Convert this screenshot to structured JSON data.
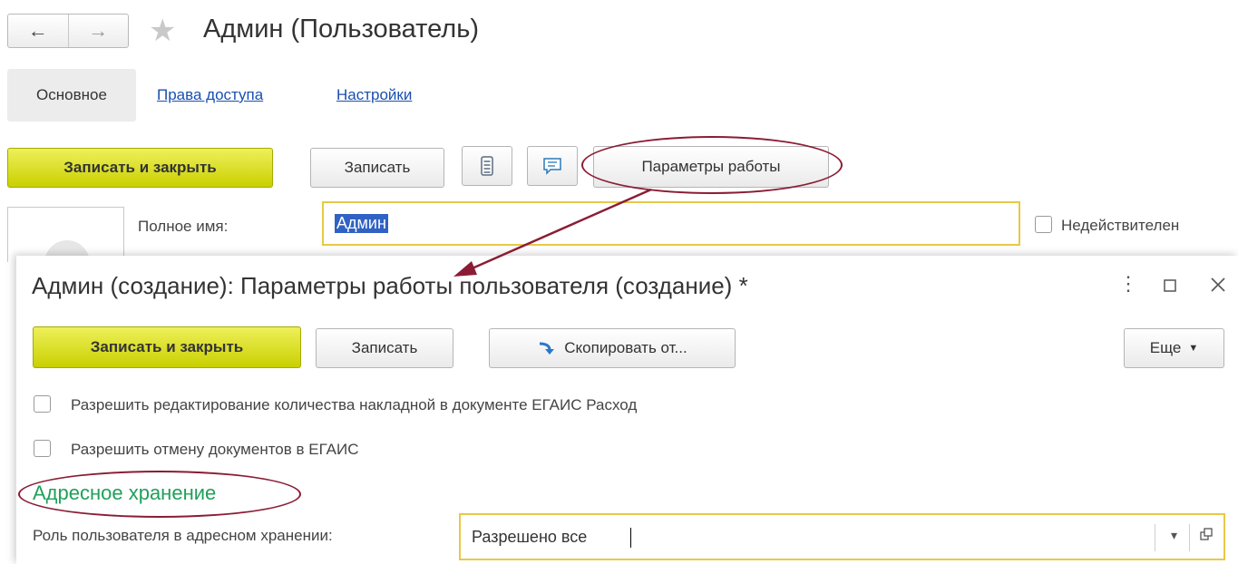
{
  "window": {
    "title": "Админ (Пользователь)",
    "nav": {
      "back": "←",
      "forward": "→"
    }
  },
  "tabs": {
    "main": "Основное",
    "access": "Права доступа",
    "settings": "Настройки"
  },
  "toolbar": {
    "save_close": "Записать и закрыть",
    "save": "Записать",
    "work_params": "Параметры работы"
  },
  "form": {
    "full_name_label": "Полное имя:",
    "full_name_value": "Админ",
    "invalid_label": "Недействителен"
  },
  "dialog": {
    "title": "Админ (создание): Параметры работы пользователя (создание) *",
    "toolbar": {
      "save_close": "Записать и закрыть",
      "save": "Записать",
      "copy_from": "Скопировать от...",
      "more": "Еще"
    },
    "options": [
      "Разрешить редактирование количества накладной в документе ЕГАИС Расход",
      "Разрешить отмену документов в ЕГАИС"
    ],
    "section_title": "Адресное хранение",
    "role_label": "Роль пользователя в адресном хранении:",
    "role_value": "Разрешено все"
  },
  "colors": {
    "accent_button": "#d8de1c",
    "annotation": "#8a1d35",
    "section_green": "#1fa05a",
    "field_highlight": "#e8c845",
    "link": "#1a4fb0"
  }
}
